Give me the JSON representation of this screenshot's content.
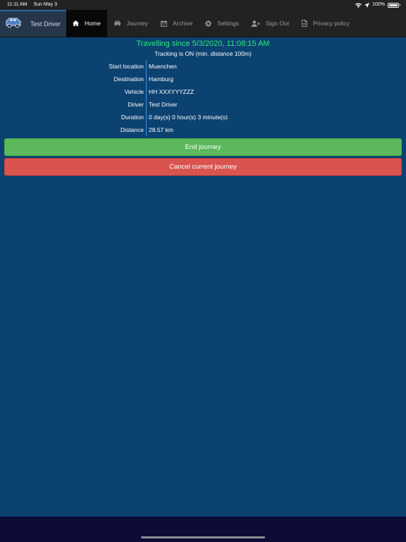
{
  "status_bar": {
    "time": "11:11 AM",
    "date": "Sun May 3",
    "battery": "100%",
    "battery_level": 1.0
  },
  "navbar": {
    "brand_name": "Test Driver",
    "items": [
      {
        "label": "Home",
        "icon": "home-icon",
        "active": true
      },
      {
        "label": "Journey",
        "icon": "car-icon",
        "active": false
      },
      {
        "label": "Archive",
        "icon": "calendar-icon",
        "active": false
      },
      {
        "label": "Settings",
        "icon": "gear-icon",
        "active": false
      },
      {
        "label": "Sign Out",
        "icon": "user-remove-icon",
        "active": false
      },
      {
        "label": "Privacy policy",
        "icon": "document-icon",
        "active": false
      }
    ]
  },
  "journey": {
    "headline": "Travelling since 5/3/2020, 11:08:15 AM",
    "tracking": "Tracking is ON (min. distance 100m)",
    "details": [
      {
        "label": "Start location",
        "value": "Muenchen"
      },
      {
        "label": "Destination",
        "value": "Hamburg"
      },
      {
        "label": "Vehicle",
        "value": "HH XXXYYYZZZ"
      },
      {
        "label": "Driver",
        "value": "Test Driver"
      },
      {
        "label": "Duration",
        "value": "0 day(s) 0 hour(s) 3 minute(s)"
      },
      {
        "label": "Distance",
        "value": "28.57 km"
      }
    ]
  },
  "actions": {
    "end_label": "End journey",
    "cancel_label": "Cancel current journey"
  },
  "colors": {
    "background": "#0c4270",
    "navbar": "#222222",
    "headline": "#2ee87c",
    "success": "#5cb85c",
    "danger": "#d9534f"
  }
}
